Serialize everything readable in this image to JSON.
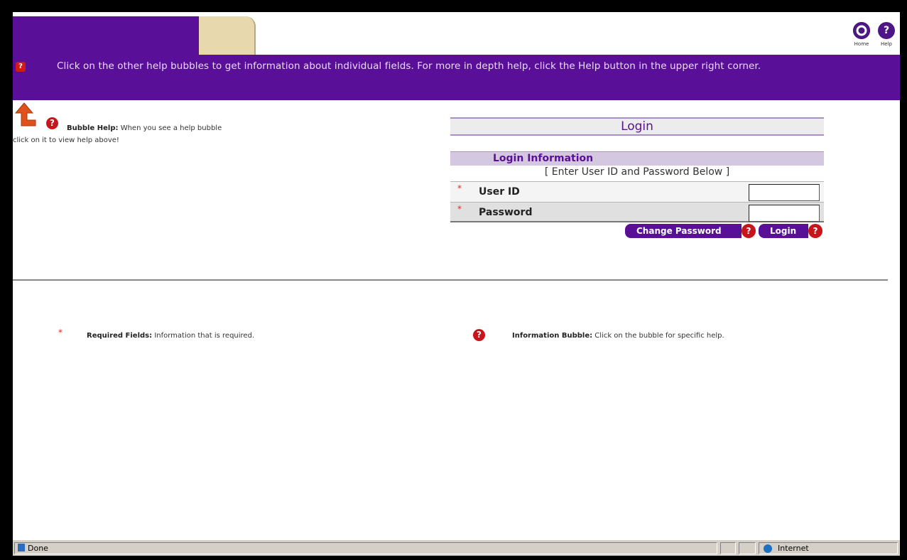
{
  "header": {
    "help_banner": "Click on the other help bubbles to get information about individual fields. For more in depth help, click the Help button in the upper right corner.",
    "home_label": "Home",
    "help_label": "Help"
  },
  "bubble_help": {
    "title": "Bubble Help:",
    "text": "When you see a help bubble",
    "text2": "click on it to view help above!"
  },
  "login": {
    "title": "Login",
    "info_header": "Login Information",
    "info_sub": "[ Enter User ID and Password Below ]",
    "required_marker": "*",
    "user_id_label": "User ID",
    "user_id_value": "",
    "password_label": "Password",
    "password_value": "",
    "change_password_label": "Change Password",
    "login_label": "Login",
    "bubble_glyph": "?"
  },
  "legend": {
    "required_marker": "*",
    "required_title": "Required Fields:",
    "required_text": "Information that is required.",
    "info_title": "Information Bubble:",
    "info_text": "Click on the bubble for specific help."
  },
  "statusbar": {
    "status_text": "Done",
    "zone_text": "Internet"
  },
  "colors": {
    "brand_purple": "#5a0f99",
    "tab_tan": "#e8d8ae",
    "bubble_red": "#c8151b"
  }
}
